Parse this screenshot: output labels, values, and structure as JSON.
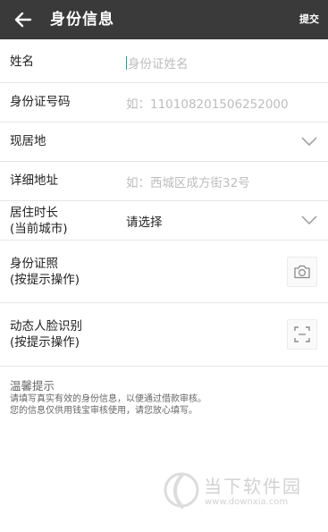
{
  "header": {
    "title": "身份信息",
    "submit_label": "提交"
  },
  "form": {
    "name": {
      "label": "姓名",
      "placeholder": "身份证姓名"
    },
    "id_number": {
      "label": "身份证号码",
      "placeholder": "如：110108201506252000"
    },
    "residence": {
      "label": "现居地"
    },
    "address": {
      "label": "详细地址",
      "placeholder": "如：西城区成方街32号"
    },
    "duration": {
      "label_line1": "居住时长",
      "label_line2": "(当前城市)",
      "value": "请选择"
    },
    "id_photo": {
      "label_line1": "身份证照",
      "label_line2": "(按提示操作)"
    },
    "face_recognition": {
      "label_line1": "动态人脸识别",
      "label_line2": "(按提示操作)"
    }
  },
  "tips": {
    "title": "温馨提示",
    "line1": "请填写真实有效的身份信息，以便通过借款审核。",
    "line2": "您的信息仅供用钱宝审核使用，请您放心填写。"
  },
  "watermark": {
    "name": "当下软件园",
    "url": "www.downxia.com"
  },
  "colors": {
    "header_bg": "#3a3a3a",
    "caret": "#1aa39a",
    "placeholder": "#bdbdbd"
  },
  "icons": [
    "back-arrow-icon",
    "chevron-down-icon",
    "camera-icon",
    "face-scan-icon",
    "watermark-logo-icon"
  ]
}
